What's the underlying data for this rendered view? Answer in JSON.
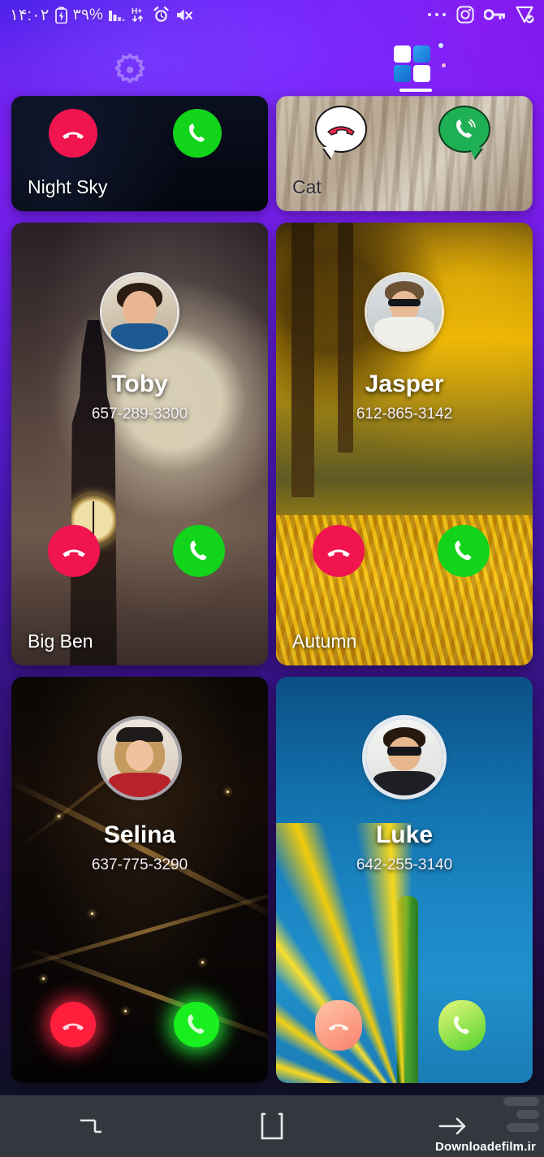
{
  "status_bar": {
    "time": "۱۴:۰۲",
    "battery_percent": "۳۹%",
    "icons": [
      {
        "name": "battery-charging-icon",
        "label": "battery charging"
      },
      {
        "name": "signal-bars-icon",
        "label": "signal"
      },
      {
        "name": "hplus-network-icon",
        "label": "H+"
      },
      {
        "name": "alarm-clock-icon",
        "label": "alarm"
      },
      {
        "name": "mute-icon",
        "label": "sound off"
      },
      {
        "name": "more-dots-icon",
        "label": "..."
      },
      {
        "name": "instagram-icon",
        "label": "Instagram"
      },
      {
        "name": "vpn-key-icon",
        "label": "VPN key"
      },
      {
        "name": "shield-check-icon",
        "label": "protected"
      }
    ]
  },
  "header": {
    "settings_icon": "gear-icon",
    "apps_tab_icon": "grid-apps-icon",
    "apps_tab_active": true
  },
  "themes": [
    {
      "id": "night-sky",
      "theme_name": "Night Sky",
      "decline_style": "circle-red",
      "accept_style": "circle-green",
      "contact": null
    },
    {
      "id": "cat",
      "theme_name": "Cat",
      "decline_style": "bubble-white",
      "accept_style": "bubble-green",
      "contact": null
    },
    {
      "id": "big-ben",
      "theme_name": "Big Ben",
      "decline_style": "circle-red",
      "accept_style": "circle-green",
      "contact": {
        "name": "Toby",
        "phone": "657-289-3300"
      }
    },
    {
      "id": "autumn",
      "theme_name": "Autumn",
      "decline_style": "circle-red",
      "accept_style": "circle-green",
      "contact": {
        "name": "Jasper",
        "phone": "612-865-3142"
      }
    },
    {
      "id": "city-night",
      "theme_name": "",
      "decline_style": "neon-red",
      "accept_style": "neon-green",
      "contact": {
        "name": "Selina",
        "phone": "637-775-3290"
      }
    },
    {
      "id": "yellow-flower",
      "theme_name": "",
      "decline_style": "soft-red",
      "accept_style": "soft-green",
      "contact": {
        "name": "Luke",
        "phone": "642-255-3140"
      }
    }
  ],
  "nav_bar": {
    "recents_icon": "recents-icon",
    "home_icon": "home-square-icon",
    "back_icon": "back-arrow-icon"
  },
  "watermark": {
    "text": "Downloadefilm.ir"
  },
  "colors": {
    "decline_red": "#f0154f",
    "accept_green": "#11d41b",
    "background_purple": "#7d1ef2",
    "nav_bar": "#33383f"
  }
}
